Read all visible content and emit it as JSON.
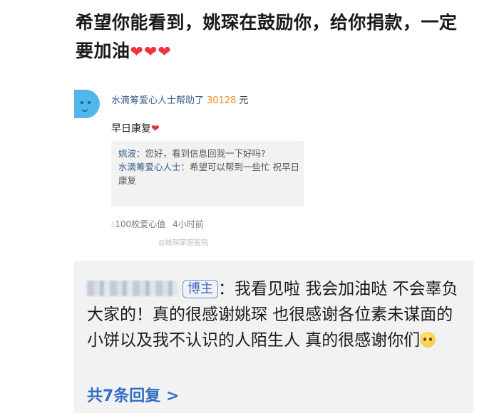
{
  "post": {
    "text": "希望你能看到，姚琛在鼓励你，给你捐款，一定要加油",
    "hearts": "❤❤❤"
  },
  "screenshot": {
    "donor_name": "水滴筹爱心人士",
    "action": "帮助了",
    "amount": "30128",
    "unit": "元",
    "message": "早日康复",
    "heart": "❤",
    "quote": {
      "line1_name": "姚波",
      "line1_text": "：您好，看到信息回我一下好吗?",
      "line2_name": "水滴筹爱心人士",
      "line2_text": "：希望可以帮到一些忙 祝早日康复"
    },
    "love_count": "100枚爱心值",
    "time": "4小时前",
    "watermark": "@姚琛家庭医院"
  },
  "reply": {
    "badge": "博主",
    "text": "：我看见啦 我会加油哒 不会辜负大家的！真的很感谢姚琛 也很感谢各位素未谋面的小饼以及我不认识的人陌生人 真的很感谢你们",
    "count_label": "共7条回复 >"
  },
  "colors": {
    "link": "#2f6ec4",
    "amount": "#f08c1f",
    "heart": "#f0343d",
    "reply_bg": "#f2f2f2"
  },
  "icons": [
    "avatar-face",
    "heart-icon",
    "water-drop-icon",
    "sad-face-emoji"
  ]
}
